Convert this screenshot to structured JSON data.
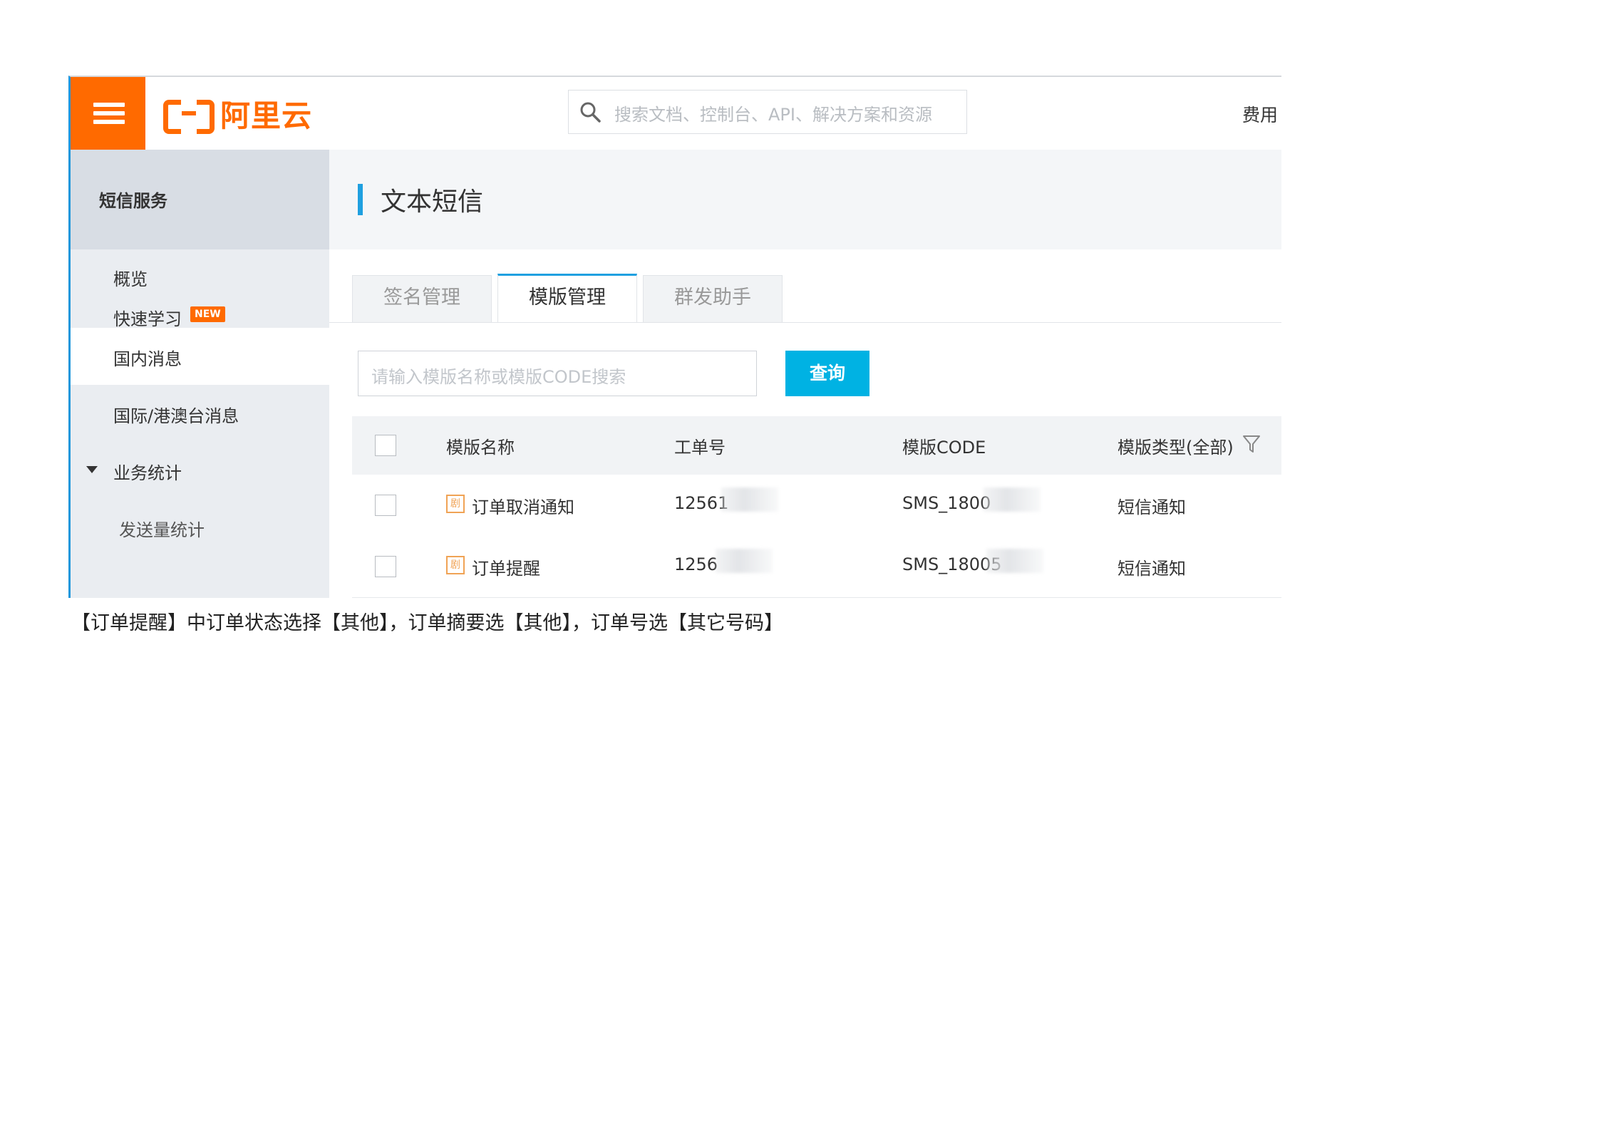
{
  "topbar": {
    "brand": "阿里云",
    "search_placeholder": "搜索文档、控制台、API、解决方案和资源",
    "fee_label": "费用",
    "colors": {
      "brand": "#ff6a00",
      "accent": "#1fa0e0",
      "button": "#00b2e3"
    }
  },
  "sidebar": {
    "header": "短信服务",
    "items": [
      {
        "label": "概览"
      },
      {
        "label": "快速学习",
        "badge": "NEW"
      },
      {
        "label": "国内消息",
        "active": true
      },
      {
        "label": "国际/港澳台消息"
      },
      {
        "label": "业务统计",
        "expanded": true
      },
      {
        "label": "发送量统计"
      }
    ]
  },
  "main": {
    "page_title": "文本短信",
    "tabs": [
      {
        "label": "签名管理"
      },
      {
        "label": "模版管理",
        "active": true
      },
      {
        "label": "群发助手"
      }
    ],
    "query": {
      "placeholder": "请输入模版名称或模版CODE搜索",
      "button": "查询"
    },
    "table": {
      "columns": [
        "模版名称",
        "工单号",
        "模版CODE",
        "模版类型(全部)"
      ],
      "rows": [
        {
          "name": "订单取消通知",
          "ticket": "12561",
          "code": "SMS_1800",
          "type": "短信通知"
        },
        {
          "name": "订单提醒",
          "ticket": "1256",
          "code": "SMS_18005",
          "type": "短信通知"
        }
      ]
    }
  },
  "caption": "【订单提醒】中订单状态选择【其他】，订单摘要选【其他】，订单号选【其它号码】"
}
